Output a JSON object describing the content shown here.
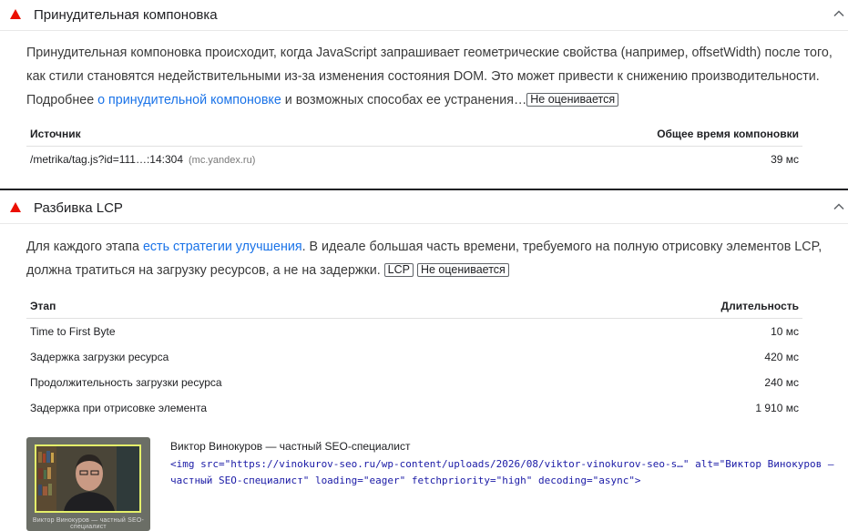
{
  "forced_layout": {
    "title": "Принудительная компоновка",
    "desc_1": "Принудительная компоновка происходит, когда JavaScript запрашивает геометрические свойства (например, offsetWidth) после того, как стили становятся недействительными из-за изменения состояния DOM. Это может привести к снижению производительности. Подробнее ",
    "desc_link": "о принудительной компоновке",
    "desc_2": " и возможных способах ее устранения…",
    "badge": "Не оценивается",
    "columns": [
      "Источник",
      "Общее время компоновки"
    ],
    "rows": [
      {
        "source": "/metrika/tag.js?id=111…:14:304",
        "host": "(mc.yandex.ru)",
        "time": "39 мс"
      }
    ]
  },
  "lcp_breakdown": {
    "title": "Разбивка LCP",
    "desc_1": "Для каждого этапа ",
    "desc_link": "есть стратегии улучшения",
    "desc_2": ". В идеале большая часть времени, требуемого на полную отрисовку элементов LCP, должна тратиться на загрузку ресурсов, а не на задержки. ",
    "badge_lcp": "LCP",
    "badge": "Не оценивается",
    "columns": [
      "Этап",
      "Длительность"
    ],
    "rows": [
      {
        "phase": "Time to First Byte",
        "duration": "10 мс"
      },
      {
        "phase": "Задержка загрузки ресурса",
        "duration": "420 мс"
      },
      {
        "phase": "Продолжительность загрузки ресурса",
        "duration": "240 мс"
      },
      {
        "phase": "Задержка при отрисовке элемента",
        "duration": "1 910 мс"
      }
    ],
    "node": {
      "label": "Виктор Винокуров — частный SEO-специалист",
      "snippet": "<img src=\"https://vinokurov-seo.ru/wp-content/uploads/2026/08/viktor-vinokurov-seo-s…\" alt=\"Виктор Винокуров — частный SEO-специалист\" loading=\"eager\" fetchpriority=\"high\" decoding=\"async\">",
      "thumb_caption": "Виктор Винокуров — частный SEO-специалист"
    }
  },
  "colors": {
    "fail": "#eb0f00",
    "link": "#1a73e8",
    "code": "#1a1aa6"
  }
}
